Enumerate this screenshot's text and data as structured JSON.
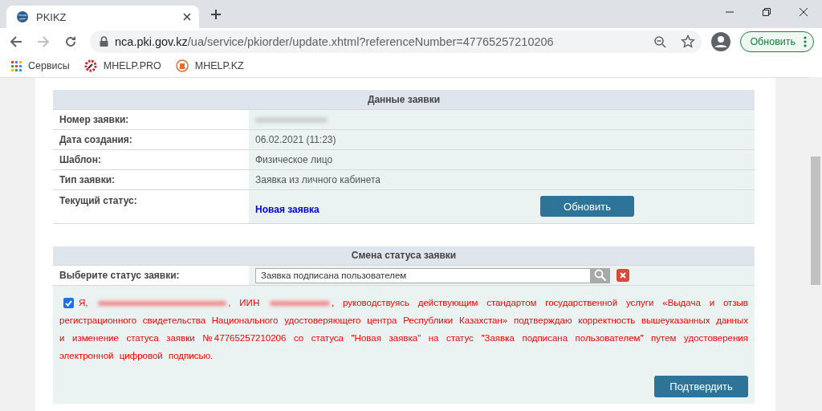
{
  "browser": {
    "tab": {
      "title": "PKIKZ",
      "selected": true
    },
    "url": "nca.pki.gov.kz/ua/service/pkiorder/update.xhtml?referenceNumber=47765257210206",
    "update_button": "Обновить",
    "bookmarks": [
      "Сервисы",
      "MHELP.PRO",
      "MHELP.KZ"
    ]
  },
  "order_data": {
    "title": "Данные заявки",
    "rows": [
      {
        "label": "Номер заявки:",
        "value": "",
        "redacted": true
      },
      {
        "label": "Дата создания:",
        "value": "06.02.2021 (11:23)",
        "redacted": false
      },
      {
        "label": "Шаблон:",
        "value": "Физическое лицо",
        "redacted": false
      },
      {
        "label": "Тип заявки:",
        "value": "Заявка из личного кабинета",
        "redacted": false
      }
    ],
    "status": {
      "label": "Текущий статус:",
      "value": "Новая заявка",
      "button": "Обновить"
    }
  },
  "status_change": {
    "title": "Смена статуса заявки",
    "label": "Выберите статус заявки:",
    "value": "Заявка подписана пользователем",
    "consent": {
      "checked": true,
      "parts": [
        "Я,",
        ", ИИН",
        ", руководствуясь действующим стандартом государственной услуги «Выдача и отзыв регистрационного свидетельства Национального удостоверяющего центра Республики Казахстан» подтверждаю корректность вышеуказанных данных и изменение статуса заявки №47765257210206 со статуса \"Новая заявка\" на статус \"Заявка подписана пользователем\" путем удостоверения электронной цифровой подписью."
      ]
    },
    "confirm_button": "Подтвердить"
  }
}
